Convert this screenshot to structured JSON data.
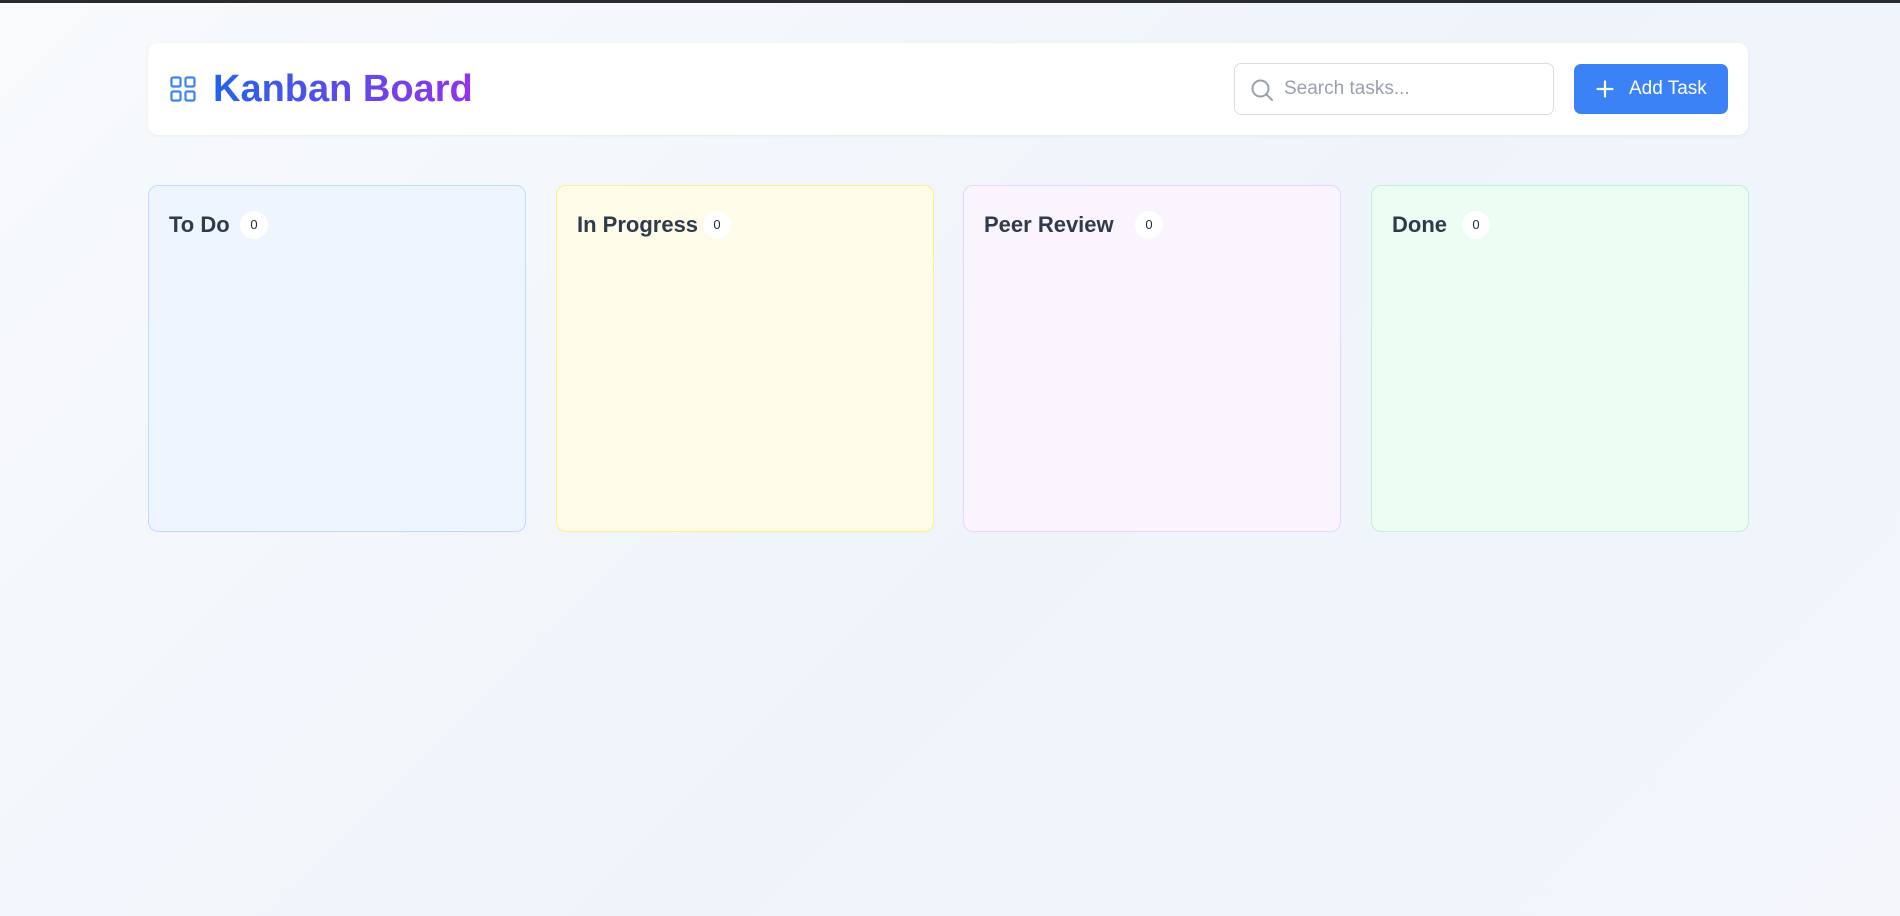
{
  "header": {
    "title": "Kanban Board",
    "logo_icon": "grid-icon",
    "search": {
      "placeholder": "Search tasks...",
      "value": "",
      "icon": "search-icon"
    },
    "add_button": {
      "label": "Add Task",
      "icon": "plus-icon"
    }
  },
  "columns": [
    {
      "id": "todo",
      "title": "To Do",
      "count": "0",
      "tasks": []
    },
    {
      "id": "in-progress",
      "title": "In Progress",
      "count": "0",
      "tasks": []
    },
    {
      "id": "peer-review",
      "title": "Peer Review",
      "count": "0",
      "tasks": []
    },
    {
      "id": "done",
      "title": "Done",
      "count": "0",
      "tasks": []
    }
  ],
  "colors": {
    "accent": "#3b82f6",
    "title_gradient_start": "#2563eb",
    "title_gradient_end": "#9333ea",
    "todo_bg": "#eef5ff",
    "in_progress_bg": "#fefbe8",
    "peer_review_bg": "#faf4fe",
    "done_bg": "#ecfdf3"
  }
}
